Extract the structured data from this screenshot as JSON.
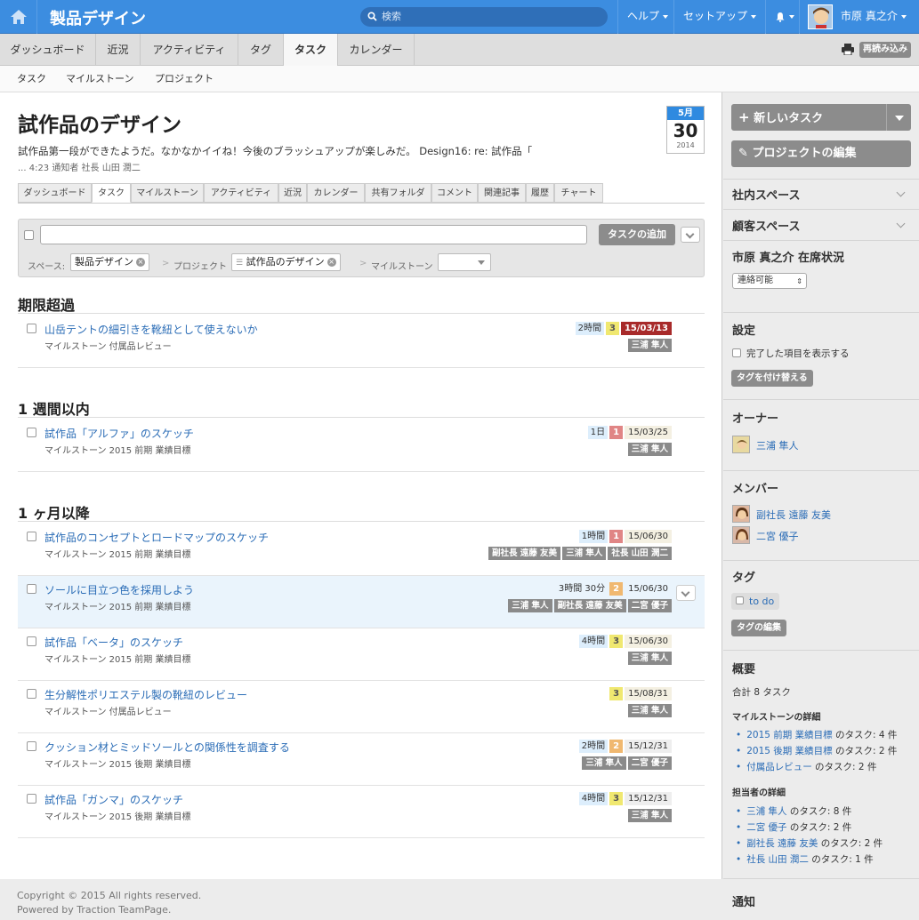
{
  "topbar": {
    "app_title": "製品デザイン",
    "search_placeholder": "検索",
    "help": "ヘルプ",
    "setup": "セットアップ",
    "user_name": "市原 真之介"
  },
  "nav": {
    "tabs": [
      "ダッシュボード",
      "近況",
      "アクティビティ",
      "タグ",
      "タスク",
      "カレンダー"
    ],
    "active": "タスク",
    "reload": "再読み込み"
  },
  "subnav": [
    "タスク",
    "マイルストーン",
    "プロジェクト"
  ],
  "project": {
    "title": "試作品のデザイン",
    "description": "試作品第一段ができたようだ。なかなかイイね！今後のブラッシュアップが楽しみだ。 Design16: re: 試作品「",
    "meta": "... 4:23 通知者 社長 山田 潤二",
    "calendar": {
      "month": "5月",
      "day": "30",
      "year": "2014"
    },
    "tabs": [
      "ダッシュボード",
      "タスク",
      "マイルストーン",
      "アクティビティ",
      "近況",
      "カレンダー",
      "共有フォルダ",
      "コメント",
      "関連記事",
      "履歴",
      "チャート"
    ],
    "active_tab": "タスク"
  },
  "filter": {
    "add_button": "タスクの追加",
    "space_label": "スペース:",
    "space_value": "製品デザイン",
    "project_label": "プロジェクト",
    "project_value": "試作品のデザイン",
    "milestone_label": "マイルストーン"
  },
  "sections": {
    "overdue": "期限超過",
    "week": "1 週間以内",
    "later": "1 ヶ月以降"
  },
  "tasks": [
    {
      "name": "山岳テントの細引きを靴紐として使えないか",
      "milestone": "マイルストーン 付属品レビュー",
      "duration": "2時間",
      "priority": "3",
      "due": "15/03/13",
      "assignees": [
        "三浦 隼人"
      ]
    },
    {
      "name": "試作品「アルファ」のスケッチ",
      "milestone": "マイルストーン 2015 前期 業績目標",
      "duration": "1日",
      "priority": "1",
      "due": "15/03/25",
      "assignees": [
        "三浦 隼人"
      ]
    },
    {
      "name": "試作品のコンセプトとロードマップのスケッチ",
      "milestone": "マイルストーン 2015 前期 業績目標",
      "duration": "1時間",
      "priority": "1",
      "due": "15/06/30",
      "assignees": [
        "副社長 遠藤 友美",
        "三浦 隼人",
        "社長 山田 潤二"
      ]
    },
    {
      "name": "ソールに目立つ色を採用しよう",
      "milestone": "マイルストーン 2015 前期 業績目標",
      "duration": "3時間 30分",
      "priority": "2",
      "due": "15/06/30",
      "assignees": [
        "三浦 隼人",
        "副社長 遠藤 友美",
        "二宮 優子"
      ]
    },
    {
      "name": "試作品「ベータ」のスケッチ",
      "milestone": "マイルストーン 2015 前期 業績目標",
      "duration": "4時間",
      "priority": "3",
      "due": "15/06/30",
      "assignees": [
        "三浦 隼人"
      ]
    },
    {
      "name": "生分解性ポリエステル製の靴紐のレビュー",
      "milestone": "マイルストーン 付属品レビュー",
      "duration": "",
      "priority": "3",
      "due": "15/08/31",
      "assignees": [
        "三浦 隼人"
      ]
    },
    {
      "name": "クッション材とミッドソールとの関係性を調査する",
      "milestone": "マイルストーン 2015 後期 業績目標",
      "duration": "2時間",
      "priority": "2",
      "due": "15/12/31",
      "assignees": [
        "三浦 隼人",
        "二宮 優子"
      ]
    },
    {
      "name": "試作品「ガンマ」のスケッチ",
      "milestone": "マイルストーン 2015 後期 業績目標",
      "duration": "4時間",
      "priority": "3",
      "due": "15/12/31",
      "assignees": [
        "三浦 隼人"
      ]
    }
  ],
  "footer": {
    "copyright": "Copyright © 2015 All rights reserved.",
    "powered": "Powered by Traction TeamPage."
  },
  "sidebar": {
    "new_task": "新しいタスク",
    "edit_project": "プロジェクトの編集",
    "internal_space": "社内スペース",
    "customer_space": "顧客スペース",
    "presence_title": "市原 真之介 在席状況",
    "presence_value": "連絡可能",
    "settings_title": "設定",
    "show_completed": "完了した項目を表示する",
    "retag": "タグを付け替える",
    "owner_title": "オーナー",
    "owner": "三浦 隼人",
    "members_title": "メンバー",
    "members": [
      "副社長 遠藤 友美",
      "二宮 優子"
    ],
    "tags_title": "タグ",
    "tag": "to do",
    "edit_tags": "タグの編集",
    "summary_title": "概要",
    "total": "合計 8 タスク",
    "milestone_detail_title": "マイルストーンの詳細",
    "milestone_details": [
      {
        "name": "2015 前期 業績目標",
        "count": "のタスク: 4 件"
      },
      {
        "name": "2015 後期 業績目標",
        "count": "のタスク: 2 件"
      },
      {
        "name": "付属品レビュー",
        "count": "のタスク: 2 件"
      }
    ],
    "assignee_detail_title": "担当者の詳細",
    "assignee_details": [
      {
        "name": "三浦 隼人",
        "count": "のタスク: 8 件"
      },
      {
        "name": "二宮 優子",
        "count": "のタスク: 2 件"
      },
      {
        "name": "副社長 遠藤 友美",
        "count": "のタスク: 2 件"
      },
      {
        "name": "社長 山田 潤二",
        "count": "のタスク: 1 件"
      }
    ],
    "notify_title": "通知"
  },
  "colors": {
    "topbar": "#3c8de0",
    "overdue": "#a82a2a",
    "link": "#2a6cb6"
  }
}
